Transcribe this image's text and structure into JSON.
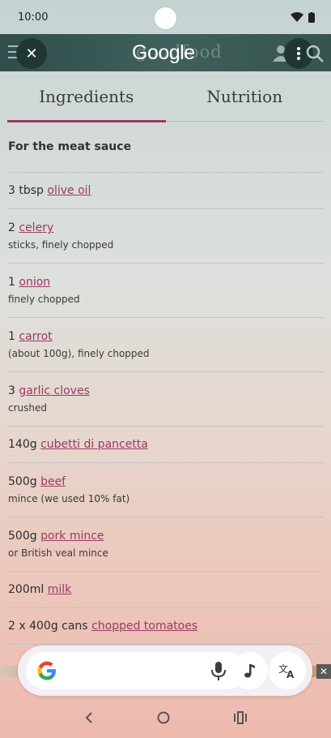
{
  "status_bar": {
    "time": "10:00"
  },
  "topbar": {
    "brand_faint": "goodfood",
    "logo_text": "Google"
  },
  "tabs": [
    {
      "label": "Ingredients",
      "active": true
    },
    {
      "label": "Nutrition",
      "active": false
    }
  ],
  "ingredients": {
    "section_title": "For the meat sauce",
    "items": [
      {
        "qty": "3 tbsp",
        "link": "olive oil",
        "note": ""
      },
      {
        "qty": "2",
        "link": "celery",
        "note": "sticks, finely chopped"
      },
      {
        "qty": "1",
        "link": "onion",
        "note": "finely chopped"
      },
      {
        "qty": "1",
        "link": "carrot",
        "note": "(about 100g), finely chopped"
      },
      {
        "qty": "3",
        "link": "garlic cloves",
        "note": "crushed"
      },
      {
        "qty": "140g",
        "link": "cubetti di pancetta",
        "note": ""
      },
      {
        "qty": "500g",
        "link": "beef",
        "note": "mince (we used 10% fat)"
      },
      {
        "qty": "500g",
        "link": "pork mince",
        "note": "or British veal mince"
      },
      {
        "qty": "200ml",
        "link": "milk",
        "note": ""
      },
      {
        "qty": "2 x 400g cans",
        "link": "chopped tomatoes",
        "note": ""
      }
    ]
  },
  "search_widget": {
    "icons": [
      "google-g-icon",
      "mic-icon",
      "music-note-icon",
      "translate-icon"
    ]
  },
  "colors": {
    "accent": "#9b3a64",
    "topbar": "#3f605c"
  }
}
